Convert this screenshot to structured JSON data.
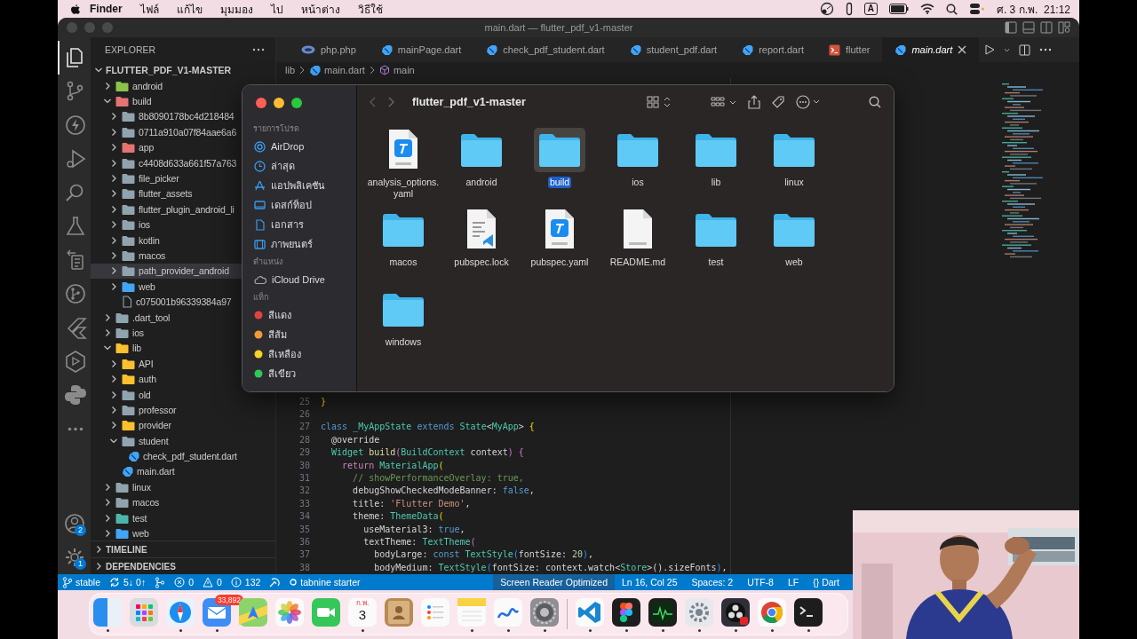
{
  "menu_bar": {
    "app": "Finder",
    "menus": [
      "ไฟล์",
      "แก้ไข",
      "มุมมอง",
      "ไป",
      "หน้าต่าง",
      "วิธีใช้"
    ],
    "input_source": "A",
    "clock": "ศ. 3 ก.พ.  21:12"
  },
  "editor_window": {
    "title": "main.dart — flutter_pdf_v1-master",
    "activity_bar": {
      "items": [
        {
          "kind": "explorer",
          "selected": true
        },
        {
          "kind": "source-control",
          "selected": false
        },
        {
          "kind": "lightning",
          "selected": false
        },
        {
          "kind": "run-debug",
          "selected": false
        },
        {
          "kind": "search",
          "selected": false
        },
        {
          "kind": "testing",
          "selected": false
        },
        {
          "kind": "remote",
          "selected": false
        },
        {
          "kind": "git-graph",
          "selected": false
        },
        {
          "kind": "flutter",
          "selected": false
        },
        {
          "kind": "extension-hex",
          "selected": false
        },
        {
          "kind": "python",
          "selected": false
        },
        {
          "kind": "more",
          "selected": false
        }
      ],
      "accounts_badge": "2",
      "settings_badge": "1"
    },
    "explorer": {
      "title": "EXPLORER",
      "root": "FLUTTER_PDF_V1-MASTER",
      "tree": [
        {
          "label": "android",
          "kind": "folder",
          "color": "#8bc34a",
          "expanded": false,
          "selected": false
        },
        {
          "label": "build",
          "kind": "folder",
          "color": "#e57373",
          "expanded": true,
          "selected": false,
          "children": [
            {
              "label": "8b8090178bc4d218484",
              "kind": "folder",
              "color": "#90a4ae",
              "expanded": false,
              "selected": false
            },
            {
              "label": "0711a910a07f84aae6a6",
              "kind": "folder",
              "color": "#90a4ae",
              "expanded": false,
              "selected": false
            },
            {
              "label": "app",
              "kind": "folder",
              "color": "#e57373",
              "expanded": false,
              "selected": false
            },
            {
              "label": "c4408d633a661f57a763",
              "kind": "folder",
              "color": "#90a4ae",
              "expanded": false,
              "selected": false
            },
            {
              "label": "file_picker",
              "kind": "folder",
              "color": "#90a4ae",
              "expanded": false,
              "selected": false
            },
            {
              "label": "flutter_assets",
              "kind": "folder",
              "color": "#90a4ae",
              "expanded": false,
              "selected": false
            },
            {
              "label": "flutter_plugin_android_li",
              "kind": "folder",
              "color": "#90a4ae",
              "expanded": false,
              "selected": false
            },
            {
              "label": "ios",
              "kind": "folder",
              "color": "#90a4ae",
              "expanded": false,
              "selected": false
            },
            {
              "label": "kotlin",
              "kind": "folder",
              "color": "#90a4ae",
              "expanded": false,
              "selected": false
            },
            {
              "label": "macos",
              "kind": "folder",
              "color": "#90a4ae",
              "expanded": false,
              "selected": false
            },
            {
              "label": "path_provider_android",
              "kind": "folder",
              "color": "#90a4ae",
              "expanded": false,
              "selected": true
            },
            {
              "label": "web",
              "kind": "folder",
              "color": "#42a5f5",
              "expanded": false,
              "selected": false
            },
            {
              "label": "c075001b96339384a97",
              "kind": "file",
              "selected": false
            }
          ]
        },
        {
          "label": ".dart_tool",
          "kind": "folder",
          "color": "#90a4ae",
          "expanded": false,
          "selected": false
        },
        {
          "label": "ios",
          "kind": "folder",
          "color": "#90a4ae",
          "expanded": false,
          "selected": false
        },
        {
          "label": "lib",
          "kind": "folder",
          "color": "#fbc02d",
          "expanded": true,
          "selected": false,
          "children": [
            {
              "label": "API",
              "kind": "folder",
              "color": "#fbc02d",
              "expanded": false,
              "selected": false
            },
            {
              "label": "auth",
              "kind": "folder",
              "color": "#fbc02d",
              "expanded": false,
              "selected": false
            },
            {
              "label": "old",
              "kind": "folder",
              "color": "#90a4ae",
              "expanded": false,
              "selected": false
            },
            {
              "label": "professor",
              "kind": "folder",
              "color": "#90a4ae",
              "expanded": false,
              "selected": false
            },
            {
              "label": "provider",
              "kind": "folder",
              "color": "#fbc02d",
              "expanded": false,
              "selected": false
            },
            {
              "label": "student",
              "kind": "folder",
              "color": "#90a4ae",
              "expanded": true,
              "selected": false,
              "children": [
                {
                  "label": "check_pdf_student.dart",
                  "kind": "dart",
                  "selected": false
                }
              ]
            },
            {
              "label": "main.dart",
              "kind": "dart",
              "selected": false
            }
          ]
        },
        {
          "label": "linux",
          "kind": "folder",
          "color": "#90a4ae",
          "expanded": false,
          "selected": false
        },
        {
          "label": "macos",
          "kind": "folder",
          "color": "#90a4ae",
          "expanded": false,
          "selected": false
        },
        {
          "label": "test",
          "kind": "folder",
          "color": "#4db6ac",
          "expanded": false,
          "selected": false
        },
        {
          "label": "web",
          "kind": "folder",
          "color": "#42a5f5",
          "expanded": false,
          "selected": false
        }
      ],
      "sections": [
        "TIMELINE",
        "DEPENDENCIES"
      ]
    },
    "tabs": [
      {
        "label": "php.php",
        "kind": "php",
        "selected": false,
        "preview": false
      },
      {
        "label": "mainPage.dart",
        "kind": "dart",
        "selected": false,
        "preview": false
      },
      {
        "label": "check_pdf_student.dart",
        "kind": "dart",
        "selected": false,
        "preview": false
      },
      {
        "label": "student_pdf.dart",
        "kind": "dart",
        "selected": false,
        "preview": false
      },
      {
        "label": "report.dart",
        "kind": "dart",
        "selected": false,
        "preview": false
      },
      {
        "label": "flutter",
        "kind": "terminal",
        "selected": false,
        "preview": false
      },
      {
        "label": "main.dart",
        "kind": "dart",
        "selected": true,
        "preview": true
      }
    ],
    "breadcrumb": [
      {
        "label": "lib",
        "kind": "folder"
      },
      {
        "label": "main.dart",
        "kind": "dart"
      },
      {
        "label": "main",
        "kind": "symbol"
      }
    ],
    "code": [
      {
        "number": "25",
        "tokens": [
          {
            "kind": "brace",
            "text": "}"
          }
        ]
      },
      {
        "number": "26"
      },
      {
        "number": "27",
        "tokens": [
          {
            "kind": "keyword",
            "text": "class "
          },
          {
            "kind": "type",
            "text": "_MyAppState "
          },
          {
            "kind": "keyword",
            "text": "extends "
          },
          {
            "kind": "type",
            "text": "State"
          },
          {
            "kind": "plain",
            "text": "<"
          },
          {
            "kind": "type",
            "text": "MyApp"
          },
          {
            "kind": "plain",
            "text": "> "
          },
          {
            "kind": "brace",
            "text": "{"
          }
        ]
      },
      {
        "number": "28",
        "tokens": [
          {
            "kind": "plain",
            "text": "  @override"
          }
        ]
      },
      {
        "number": "29",
        "tokens": [
          {
            "kind": "type",
            "text": "  Widget "
          },
          {
            "kind": "function",
            "text": "build"
          },
          {
            "kind": "paren",
            "text": "("
          },
          {
            "kind": "type",
            "text": "BuildContext "
          },
          {
            "kind": "plain",
            "text": "context"
          },
          {
            "kind": "paren",
            "text": ") {"
          }
        ]
      },
      {
        "number": "30",
        "tokens": [
          {
            "kind": "control",
            "text": "    return "
          },
          {
            "kind": "type",
            "text": "MaterialApp"
          },
          {
            "kind": "brace",
            "text": "("
          }
        ]
      },
      {
        "number": "31",
        "tokens": [
          {
            "kind": "comment",
            "text": "      // showPerformanceOverlay: true,"
          }
        ]
      },
      {
        "number": "32",
        "tokens": [
          {
            "kind": "plain",
            "text": "      debugShowCheckedModeBanner: "
          },
          {
            "kind": "keyword",
            "text": "false"
          },
          {
            "kind": "plain",
            "text": ","
          }
        ]
      },
      {
        "number": "33",
        "tokens": [
          {
            "kind": "plain",
            "text": "      title: "
          },
          {
            "kind": "string",
            "text": "'Flutter Demo'"
          },
          {
            "kind": "plain",
            "text": ","
          }
        ]
      },
      {
        "number": "34",
        "tokens": [
          {
            "kind": "plain",
            "text": "      theme: "
          },
          {
            "kind": "type",
            "text": "ThemeData"
          },
          {
            "kind": "brace",
            "text": "("
          }
        ]
      },
      {
        "number": "35",
        "tokens": [
          {
            "kind": "plain",
            "text": "        useMaterial3: "
          },
          {
            "kind": "keyword",
            "text": "true"
          },
          {
            "kind": "plain",
            "text": ","
          }
        ]
      },
      {
        "number": "36",
        "tokens": [
          {
            "kind": "plain",
            "text": "        textTheme: "
          },
          {
            "kind": "type",
            "text": "TextTheme"
          },
          {
            "kind": "paren",
            "text": "("
          }
        ]
      },
      {
        "number": "37",
        "tokens": [
          {
            "kind": "plain",
            "text": "          bodyLarge: "
          },
          {
            "kind": "keyword",
            "text": "const "
          },
          {
            "kind": "type",
            "text": "TextStyle"
          },
          {
            "kind": "blue-paren",
            "text": "("
          },
          {
            "kind": "plain",
            "text": "fontSize: "
          },
          {
            "kind": "number",
            "text": "20"
          },
          {
            "kind": "blue-paren",
            "text": ")"
          },
          {
            "kind": "plain",
            "text": ","
          }
        ]
      },
      {
        "number": "38",
        "tokens": [
          {
            "kind": "plain",
            "text": "          bodyMedium: "
          },
          {
            "kind": "type",
            "text": "TextStyle"
          },
          {
            "kind": "blue-paren",
            "text": "("
          },
          {
            "kind": "plain",
            "text": "fontSize: context.watch<"
          },
          {
            "kind": "type",
            "text": "Store"
          },
          {
            "kind": "plain",
            "text": ">().sizeFonts"
          },
          {
            "kind": "blue-paren",
            "text": ")"
          },
          {
            "kind": "plain",
            "text": ","
          }
        ]
      }
    ],
    "status_bar": {
      "left": [
        {
          "kind": "branch",
          "text": "stable"
        },
        {
          "kind": "sync",
          "text": "5↓ 0↑"
        },
        {
          "kind": "graph"
        },
        {
          "kind": "errors",
          "text": "0"
        },
        {
          "kind": "warnings",
          "text": "0"
        },
        {
          "kind": "info",
          "text": "132"
        },
        {
          "kind": "live"
        },
        {
          "kind": "tabnine",
          "text": "tabnine starter"
        }
      ],
      "right": [
        {
          "text": "Screen Reader Optimized",
          "highlighted": true
        },
        {
          "text": "Ln 16, Col 25",
          "highlighted": false
        },
        {
          "text": "Spaces: 2",
          "highlighted": false
        },
        {
          "text": "UTF-8",
          "highlighted": false
        },
        {
          "text": "LF",
          "highlighted": false
        },
        {
          "text": "{} Dart",
          "highlighted": false
        }
      ]
    }
  },
  "finder": {
    "title": "flutter_pdf_v1-master",
    "sidebar": [
      {
        "title": "รายการโปรด",
        "items": [
          {
            "label": "AirDrop",
            "kind": "airdrop"
          },
          {
            "label": "ล่าสุด",
            "kind": "recent"
          },
          {
            "label": "แอปพลิเคชัน",
            "kind": "apps"
          },
          {
            "label": "เดสก์ท็อป",
            "kind": "desktop"
          },
          {
            "label": "เอกสาร",
            "kind": "document"
          },
          {
            "label": "ภาพยนตร์",
            "kind": "movies"
          }
        ]
      },
      {
        "title": "ตำแหน่ง",
        "items": [
          {
            "label": "iCloud Drive",
            "kind": "cloud"
          }
        ]
      },
      {
        "title": "แท็ก",
        "items": [
          {
            "label": "สีแดง",
            "kind": "tag",
            "color": "#e0443e"
          },
          {
            "label": "สีส้ม",
            "kind": "tag",
            "color": "#f09a37"
          },
          {
            "label": "สีเหลือง",
            "kind": "tag",
            "color": "#f5d328"
          },
          {
            "label": "สีเขียว",
            "kind": "tag",
            "color": "#32c759"
          }
        ]
      }
    ],
    "files": [
      {
        "name": "analysis_options.yaml",
        "kind": "yaml",
        "selected": false
      },
      {
        "name": "android",
        "kind": "folder",
        "selected": false
      },
      {
        "name": "build",
        "kind": "folder",
        "selected": true
      },
      {
        "name": "ios",
        "kind": "folder",
        "selected": false
      },
      {
        "name": "lib",
        "kind": "folder",
        "selected": false
      },
      {
        "name": "linux",
        "kind": "folder",
        "selected": false
      },
      {
        "name": "macos",
        "kind": "folder",
        "selected": false
      },
      {
        "name": "pubspec.lock",
        "kind": "lock",
        "selected": false
      },
      {
        "name": "pubspec.yaml",
        "kind": "yaml",
        "selected": false
      },
      {
        "name": "README.md",
        "kind": "md",
        "selected": false
      },
      {
        "name": "test",
        "kind": "folder",
        "selected": false
      },
      {
        "name": "web",
        "kind": "folder",
        "selected": false
      },
      {
        "name": "windows",
        "kind": "folder",
        "selected": false
      }
    ]
  },
  "dock": {
    "items": [
      {
        "kind": "finder",
        "running": true
      },
      {
        "kind": "launchpad",
        "running": false
      },
      {
        "kind": "safari",
        "running": true
      },
      {
        "kind": "mail",
        "running": true,
        "badge": "33,892"
      },
      {
        "kind": "maps",
        "running": false
      },
      {
        "kind": "photos",
        "running": false
      },
      {
        "kind": "facetime",
        "running": false
      },
      {
        "kind": "calendar",
        "running": true,
        "month": "ก.พ.",
        "day": "3"
      },
      {
        "kind": "contacts",
        "running": false
      },
      {
        "kind": "reminders",
        "running": false
      },
      {
        "kind": "notes",
        "running": true
      },
      {
        "kind": "freeform",
        "running": true
      },
      {
        "kind": "settings",
        "running": true
      },
      {
        "kind": "divider"
      },
      {
        "kind": "vscode",
        "running": true
      },
      {
        "kind": "figma",
        "running": true
      },
      {
        "kind": "activity",
        "running": true
      },
      {
        "kind": "preferences",
        "running": true
      },
      {
        "kind": "obs",
        "running": true
      },
      {
        "kind": "chrome",
        "running": true
      },
      {
        "kind": "terminal",
        "running": true
      }
    ]
  }
}
